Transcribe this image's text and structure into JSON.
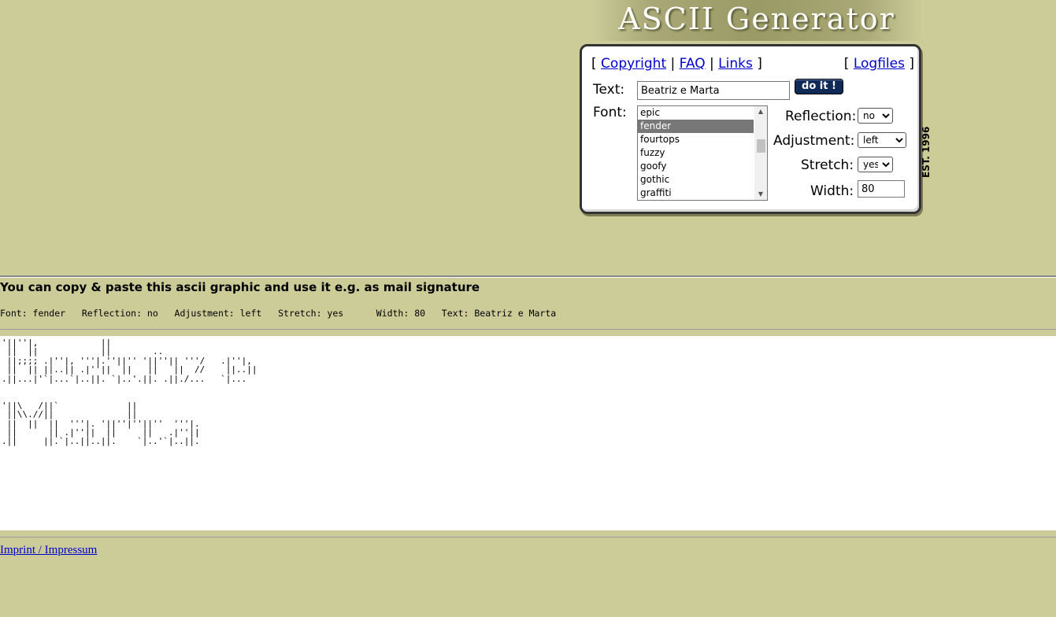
{
  "header": {
    "title": "ASCII Generator",
    "est": "EST. 1996"
  },
  "nav": {
    "bracket_open": "[",
    "bracket_close": "]",
    "separator": "|",
    "links": [
      "Copyright",
      "FAQ",
      "Links"
    ],
    "logfiles": "Logfiles"
  },
  "form": {
    "text_label": "Text:",
    "text_value": "Beatriz e Marta",
    "submit_label": "do it !",
    "font_label": "Font:",
    "font_options": [
      "epic",
      "fender",
      "fourtops",
      "fuzzy",
      "goofy",
      "gothic",
      "graffiti"
    ],
    "font_selected": "fender",
    "reflection_label": "Reflection:",
    "reflection_value": "no",
    "adjustment_label": "Adjustment:",
    "adjustment_value": "left",
    "stretch_label": "Stretch:",
    "stretch_value": "yes",
    "width_label": "Width:",
    "width_value": "80"
  },
  "result": {
    "heading": "You can copy & paste this ascii graphic and use it e.g. as mail signature",
    "info": "Font: fender   Reflection: no   Adjustment: left   Stretch: yes      Width: 80   Text: Beatriz e Marta",
    "ascii": "'||''|,            ||\n ||  ||            ||        ..\n ||;;;; .|''|, '''|.''||'' '||''|| '''/   .|''|,\n ||  || ||..|| .|''||  ||   ||   ||  //    ||..||\n.||...|'`|...`|..||. `|..'.||. .||./...   `|...\n\n\n'||\\   /||`             ||\n ||\\\\.//||              ||\n ||  ||  ||  '''|. '||''|''||''  '''|.\n ||      || .|''||  ||     ||   .|''||\n.||     ||.`|..||..||.    `|..'`|..||."
  },
  "footer": {
    "imprint": "Imprint / Impressum"
  }
}
